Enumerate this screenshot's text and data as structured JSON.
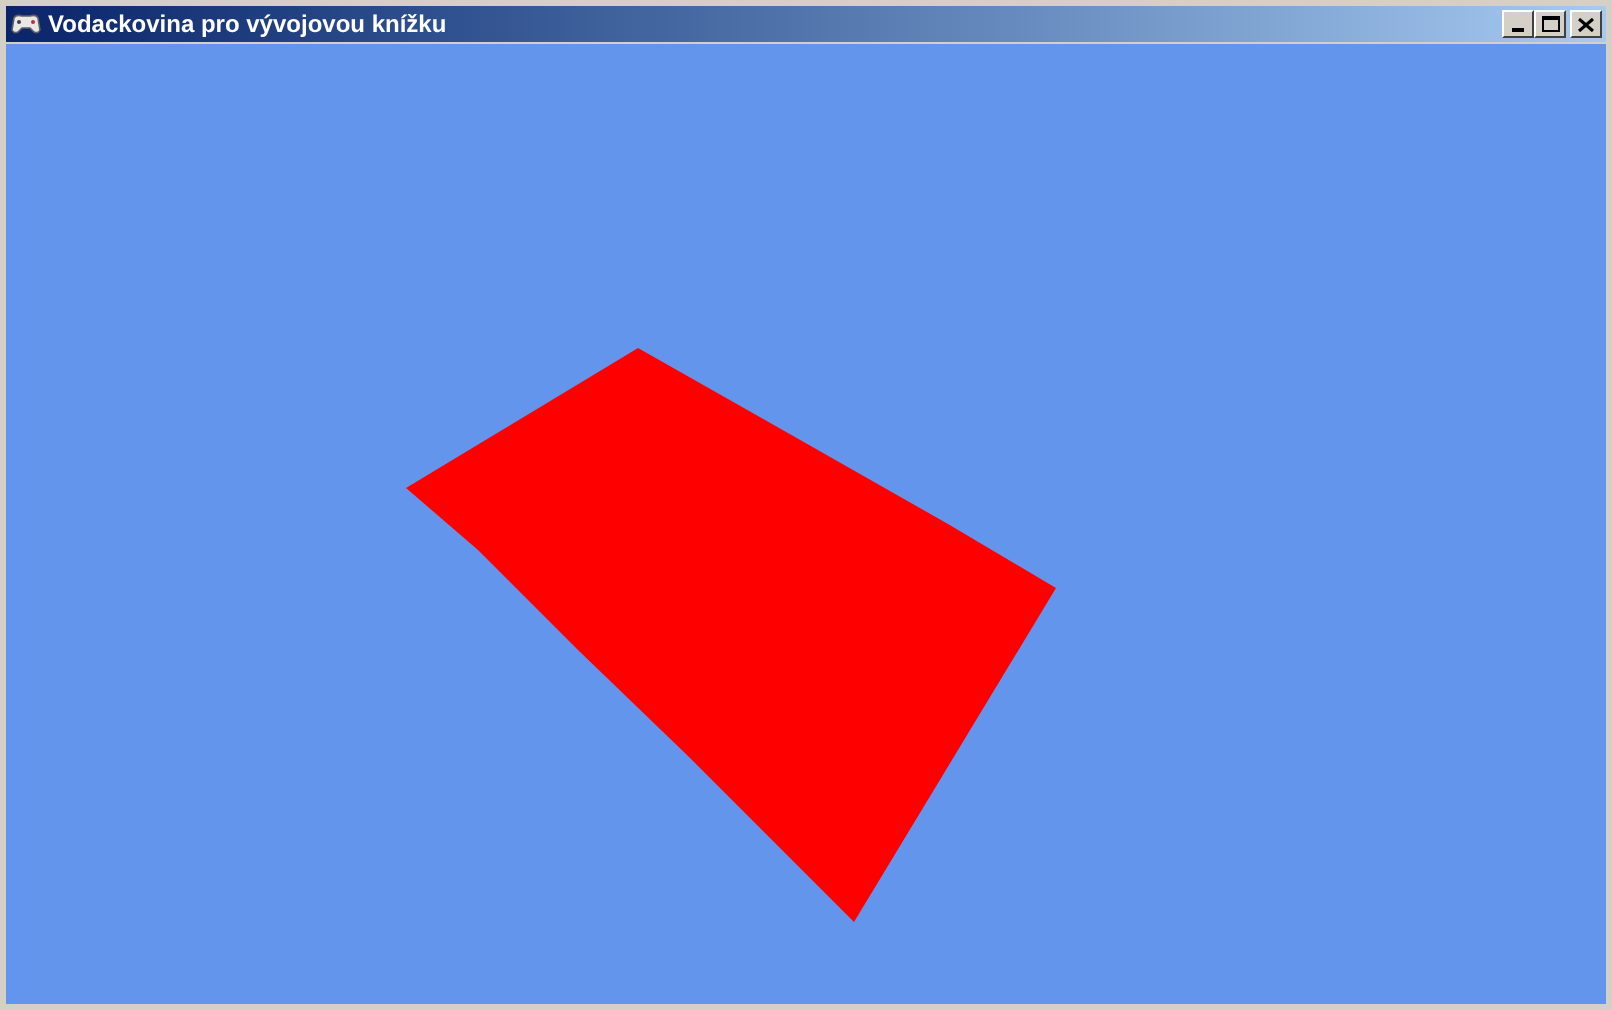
{
  "window": {
    "title": "Vodackovina pro vývojovou knížku"
  }
}
